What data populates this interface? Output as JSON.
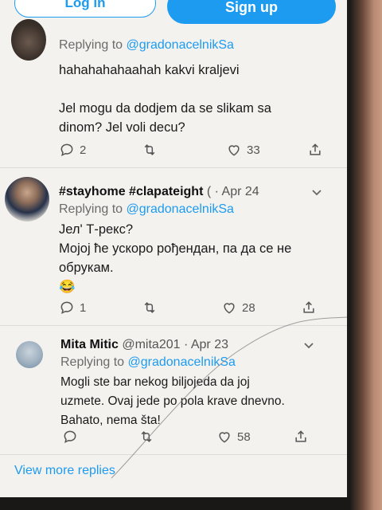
{
  "top": {
    "login_label": "Log in",
    "signup_label": "Sign up"
  },
  "tweets": [
    {
      "replying_prefix": "Replying to",
      "replying_handle": "@gradonacelnikSa",
      "body": [
        "hahahahahaahah kakvi kraljevi",
        "",
        "Jel mogu da dodjem da se slikam sa",
        "dinom? Jel voli decu?"
      ],
      "reply_count": "2",
      "like_count": "33"
    },
    {
      "name": "#stayhome #clapateight",
      "meta": "( · Apr 24",
      "replying_prefix": "Replying to",
      "replying_handle": "@gradonacelnikSa",
      "body": [
        "Јел' Т-рекс?",
        "Мојој ће ускоро рођендан, па да се не",
        "обрукам.",
        "😂"
      ],
      "reply_count": "1",
      "like_count": "28"
    },
    {
      "name": "Mita Mitic",
      "meta": "@mita201 · Apr 23",
      "replying_prefix": "Replying to",
      "replying_handle": "@gradonacelnikSa",
      "body": [
        "Mogli ste bar nekog biljojeda da joj",
        "uzmete. Ovaj jede po pola krave dnevno.",
        "Bahato, nema šta!"
      ],
      "reply_count": "",
      "like_count": "58"
    }
  ],
  "view_more": "View more replies",
  "colors": {
    "accent": "#1d9bf0",
    "text": "#1a1a1a",
    "muted": "#6b6b6b"
  },
  "icons": [
    "reply-icon",
    "retweet-icon",
    "like-icon",
    "share-icon",
    "chevron-down-icon",
    "avatar"
  ]
}
